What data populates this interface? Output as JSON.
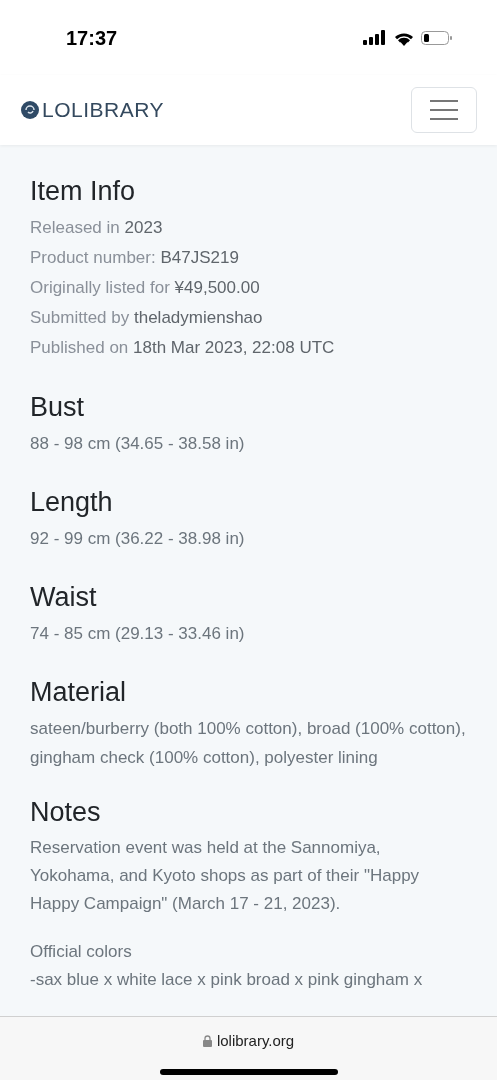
{
  "status_bar": {
    "time": "17:37"
  },
  "navbar": {
    "brand": "LOLIBRARY"
  },
  "item_info": {
    "title": "Item Info",
    "lines": [
      {
        "label": "Released in",
        "value": "2023"
      },
      {
        "label": "Product number:",
        "value": "B47JS219"
      },
      {
        "label": "Originally listed for",
        "value": "¥49,500.00"
      },
      {
        "label": "Submitted by",
        "value": "theladymienshao"
      },
      {
        "label": "Published on",
        "value": "18th Mar 2023, 22:08 UTC"
      }
    ]
  },
  "sections": [
    {
      "title": "Bust",
      "text": "88 - 98 cm (34.65 - 38.58 in)"
    },
    {
      "title": "Length",
      "text": "92 - 99 cm (36.22 - 38.98 in)"
    },
    {
      "title": "Waist",
      "text": "74 - 85 cm (29.13 - 33.46 in)"
    },
    {
      "title": "Material",
      "text": "sateen/burberry (both 100% cotton), broad (100% cotton), gingham check (100% cotton), polyester lining"
    }
  ],
  "notes": {
    "title": "Notes",
    "paragraphs": [
      "Reservation event was held at the Sannomiya, Yokohama, and Kyoto shops as part of their \"Happy Happy Campaign\" (March 17 - 21, 2023).",
      "Official colors",
      "-sax blue x white lace x pink broad x pink gingham x"
    ]
  },
  "browser_bar": {
    "url": "lolibrary.org"
  }
}
